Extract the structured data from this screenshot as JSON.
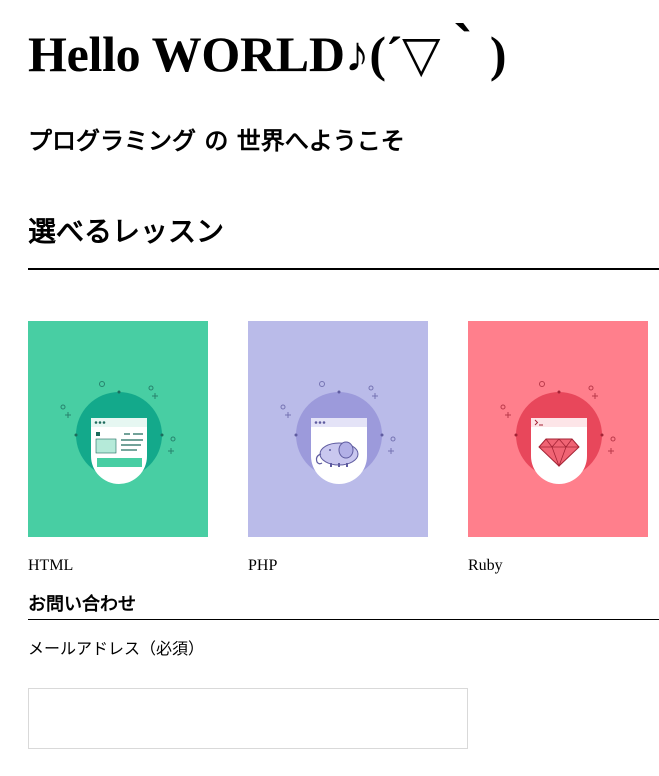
{
  "hero": {
    "title": "Hello WORLD♪(´▽｀)",
    "subtitle": "プログラミング の 世界へようこそ"
  },
  "lessons": {
    "heading": "選べるレッスン",
    "items": [
      {
        "label": "HTML",
        "bg_color": "#48cea3",
        "accent": "#13a98b",
        "icon": "html-window-icon"
      },
      {
        "label": "PHP",
        "bg_color": "#babbe9",
        "accent": "#9c9adb",
        "icon": "php-elephant-icon"
      },
      {
        "label": "Ruby",
        "bg_color": "#ff7f8c",
        "accent": "#e8475b",
        "icon": "ruby-gem-icon"
      }
    ]
  },
  "contact": {
    "heading": "お問い合わせ",
    "email_label": "メールアドレス（必須）",
    "email_value": "",
    "email_placeholder": ""
  }
}
